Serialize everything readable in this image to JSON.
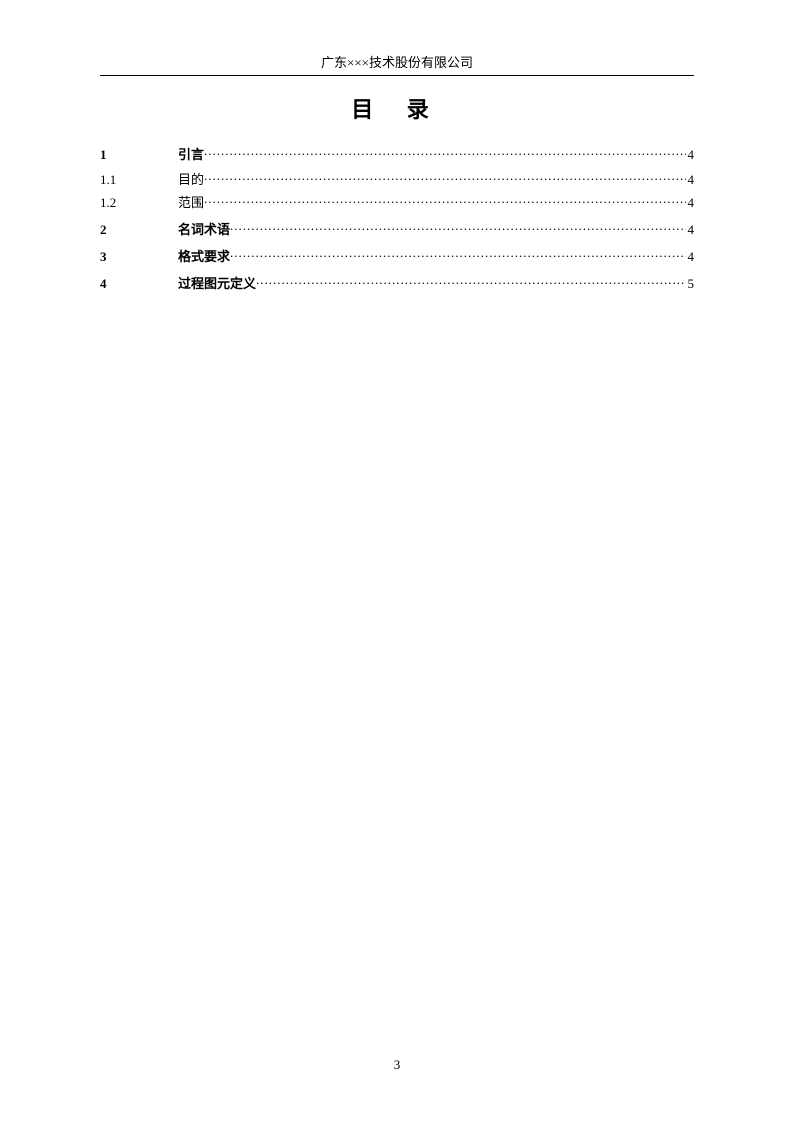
{
  "header": "广东×××技术股份有限公司",
  "title": "目  录",
  "toc": [
    {
      "num": "1",
      "label": "引言",
      "page": "4",
      "bold": true
    },
    {
      "num": "1.1",
      "label": "目的",
      "page": "4",
      "bold": false
    },
    {
      "num": "1.2",
      "label": "范围",
      "page": "4",
      "bold": false
    },
    {
      "num": "2",
      "label": "名词术语",
      "page": "4",
      "bold": true
    },
    {
      "num": "3",
      "label": "格式要求",
      "page": "4",
      "bold": true
    },
    {
      "num": "4",
      "label": "过程图元定义",
      "page": "5",
      "bold": true
    }
  ],
  "pageNumber": "3"
}
